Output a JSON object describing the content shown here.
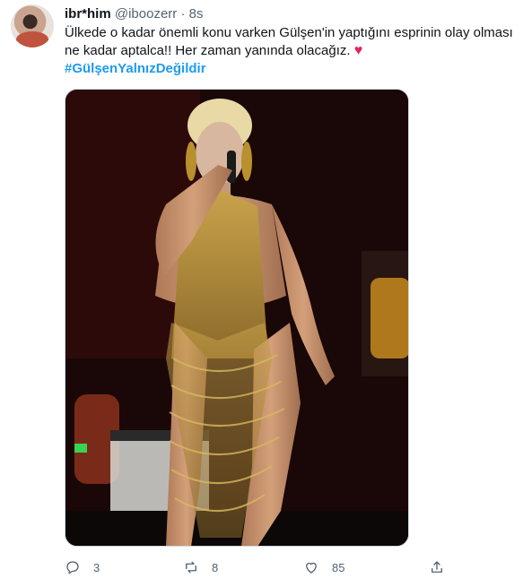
{
  "tweet": {
    "display_name": "ibr*him",
    "handle": "@iboozerr",
    "separator": "·",
    "time": "8s",
    "text_line1": "Ülkede o kadar önemli konu varken Gülşen'in yaptığını esprinin olay olması",
    "text_line2": "ne kadar aptalca!! Her zaman yanında olacağız.",
    "heart_glyph": "♥",
    "hashtag": "#GülşenYalnızDeğildir"
  },
  "actions": {
    "reply_count": "3",
    "retweet_count": "8",
    "like_count": "85"
  },
  "colors": {
    "link": "#1d9bf0",
    "muted": "#536471",
    "heart": "#e0245e"
  }
}
